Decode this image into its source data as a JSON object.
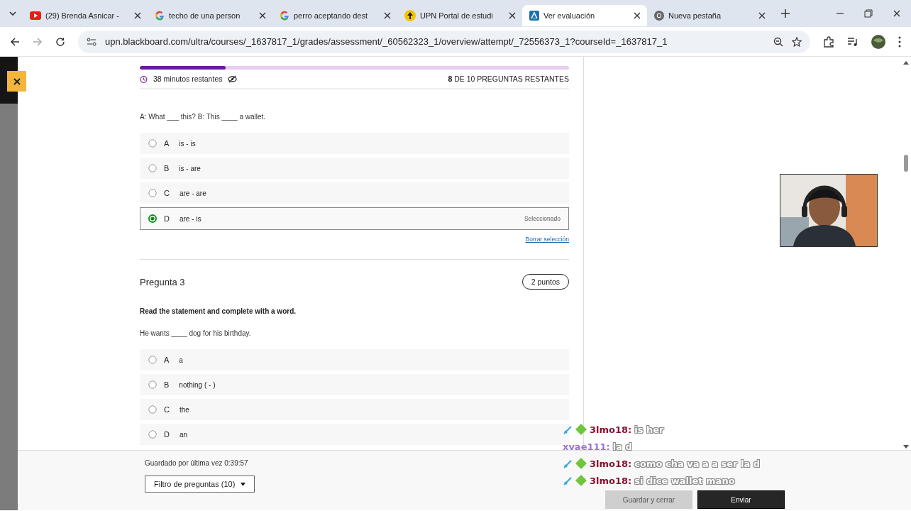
{
  "browser": {
    "tabs": [
      {
        "title": "(29) Brenda Asnicar -",
        "selected": false
      },
      {
        "title": "techo de una person",
        "selected": false
      },
      {
        "title": "perro aceptando dest",
        "selected": false
      },
      {
        "title": "UPN Portal de estudi",
        "selected": false
      },
      {
        "title": "Ver evaluación",
        "selected": true
      },
      {
        "title": "Nueva pestaña",
        "selected": false
      }
    ],
    "url": "upn.blackboard.com/ultra/courses/_1637817_1/grades/assessment/_60562323_1/overview/attempt/_72556373_1?courseId=_1637817_1"
  },
  "quiz": {
    "progress": {
      "level": 0.2
    },
    "time_left": "38 minutos restantes",
    "questions_left": "**8** DE 10 PREGUNTAS RESTANTES",
    "questions": [
      {
        "prompt": "A: What ___ this? B: This ____ a wallet.",
        "options": [
          {
            "letter": "A",
            "text": "is - is",
            "selected": false
          },
          {
            "letter": "B",
            "text": "is - are",
            "selected": false
          },
          {
            "letter": "C",
            "text": "are - are",
            "selected": false
          },
          {
            "letter": "D",
            "text": "are - is",
            "selected": true
          }
        ],
        "selected_label": "Seleccionado",
        "clear_link": "Borrar selección"
      },
      {
        "title": "Pregunta 3",
        "points": "2 puntos",
        "instruction": "Read the statement and complete with a word.",
        "prompt": "He wants ____ dog for his birthday.",
        "options": [
          {
            "letter": "A",
            "text": "a",
            "selected": false
          },
          {
            "letter": "B",
            "text": "nothing ( - )",
            "selected": false
          },
          {
            "letter": "C",
            "text": "the",
            "selected": false
          },
          {
            "letter": "D",
            "text": "an",
            "selected": false
          }
        ]
      }
    ]
  },
  "footer": {
    "saved": "Guardado por última vez 0:39:57",
    "filter": "Filtro de preguntas (10)",
    "buttons": [
      {
        "label": "Guardar y cerrar",
        "kind": "secondary"
      },
      {
        "label": "Enviar",
        "kind": "primary"
      }
    ]
  },
  "chat": [
    {
      "user": "3lmo18:",
      "color": "#8b1030",
      "badges": true,
      "message": "is her"
    },
    {
      "user": "xvae111:",
      "color": "#9b72d6",
      "badges": false,
      "message": "la d"
    },
    {
      "user": "3lmo18:",
      "color": "#8b1030",
      "badges": true,
      "message": "como cha va a a ser la d"
    },
    {
      "user": "3lmo18:",
      "color": "#8b1030",
      "badges": true,
      "message": "si dice wallet mano"
    }
  ]
}
